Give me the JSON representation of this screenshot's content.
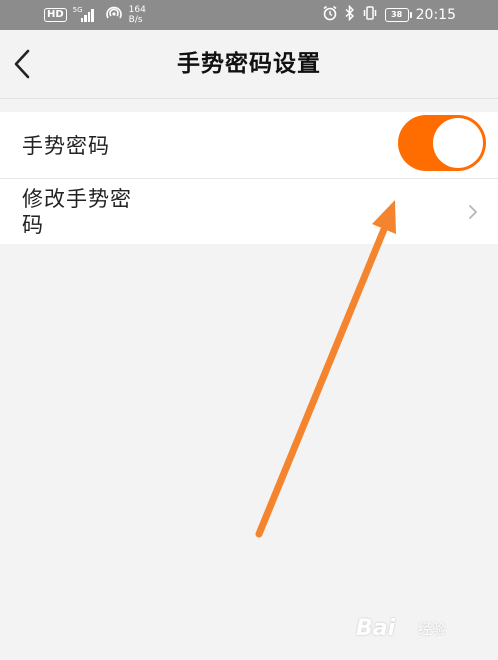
{
  "status_bar": {
    "hd": "HD",
    "network_gen": "5G",
    "speed_value": "164",
    "speed_unit": "B/s",
    "battery": "38",
    "time": "20:15"
  },
  "header": {
    "title": "手势密码设置"
  },
  "settings": {
    "gesture_password": {
      "label": "手势密码",
      "enabled": true
    },
    "change_gesture_password": {
      "label": "修改手势密码"
    }
  },
  "colors": {
    "accent": "#ff6d00",
    "arrow": "#f5842e",
    "status_bar": "#8c8c8c"
  },
  "watermark": {
    "brand": "Bai",
    "sub": "经验"
  }
}
